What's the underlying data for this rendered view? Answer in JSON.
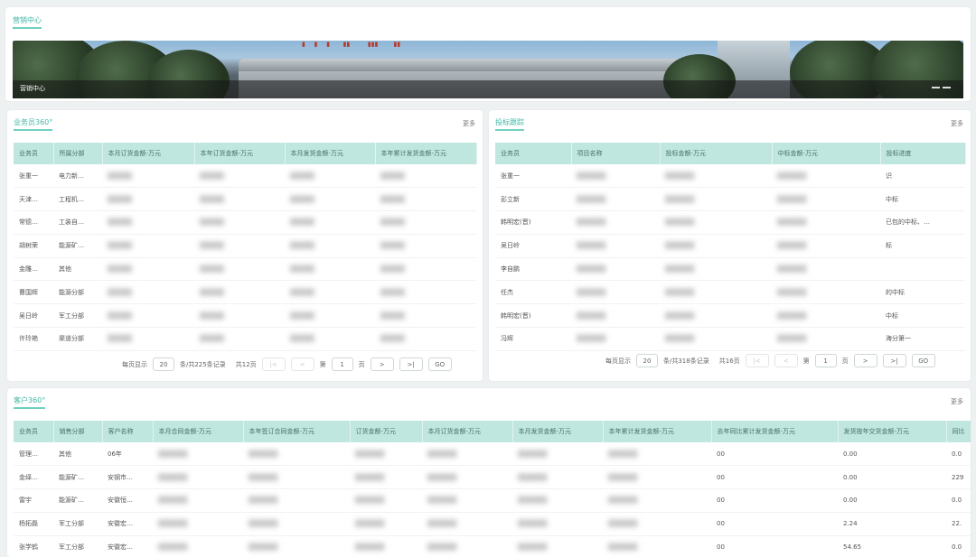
{
  "header": {
    "title": "营销中心",
    "banner_label": "营销中心"
  },
  "sales_panel": {
    "title": "业务员360°",
    "more": "更多",
    "columns": [
      "业务员",
      "所属分部",
      "本月订货金额-万元",
      "本年订货金额-万元",
      "本月发货金额-万元",
      "本年累计发货金额-万元"
    ],
    "rows": [
      [
        "张重一",
        "电力新…"
      ],
      [
        "天津…",
        "工程机…"
      ],
      [
        "常德…",
        "工装自…"
      ],
      [
        "胡树荣",
        "能源矿…"
      ],
      [
        "金雕…",
        "其他"
      ],
      [
        "曹国辉",
        "能源分部"
      ],
      [
        "吴日岭",
        "军工分部"
      ],
      [
        "许玲艳",
        "渠道分部"
      ]
    ],
    "pager": {
      "per_page_label": "每页显示",
      "per_page": "20",
      "records": "条/共225条记录",
      "total_pages": "共12页",
      "page_prefix": "第",
      "page": "1",
      "page_suffix": "页",
      "go": "GO"
    }
  },
  "bids_panel": {
    "title": "投标跟踪",
    "more": "更多",
    "columns": [
      "业务员",
      "项目名称",
      "投标金额-万元",
      "中标金额-万元",
      "投标进度"
    ],
    "rows": [
      [
        "张重一",
        "",
        "",
        "",
        "识"
      ],
      [
        "彭立新",
        "",
        "",
        "",
        "中标"
      ],
      [
        "韩明宏(晋)",
        "",
        "",
        "",
        "已包的中标、…"
      ],
      [
        "吴日岭",
        "",
        "",
        "",
        "标"
      ],
      [
        "李自鹏",
        "",
        "",
        "",
        ""
      ],
      [
        "任杰",
        "",
        "",
        "",
        "的中标"
      ],
      [
        "韩明宏(晋)",
        "",
        "",
        "",
        "中标"
      ],
      [
        "冯辉",
        "",
        "",
        "",
        "海分第一"
      ]
    ],
    "pager": {
      "per_page_label": "每页显示",
      "per_page": "20",
      "records": "条/共318条记录",
      "total_pages": "共16页",
      "page_prefix": "第",
      "page": "1",
      "page_suffix": "页",
      "go": "GO"
    }
  },
  "customer_panel": {
    "title": "客户360°",
    "more": "更多",
    "columns": [
      "业务员",
      "销售分部",
      "客户名称",
      "本月合同金额-万元",
      "本年签订合同金额-万元",
      "订货金额-万元",
      "本月订货金额-万元",
      "本月发货金额-万元",
      "本年累计发货金额-万元",
      "去年同比累计发货金额-万元",
      "发货按年交货金额-万元",
      "同比"
    ],
    "rows": [
      [
        "管理…",
        "其他",
        "06年",
        "00",
        "0.00",
        "0.0"
      ],
      [
        "金绎…",
        "能源矿…",
        "安钢市…",
        "00",
        "0.00",
        "229"
      ],
      [
        "雷宇",
        "能源矿…",
        "安徽恒…",
        "00",
        "0.00",
        "0.0"
      ],
      [
        "杨拓磊",
        "军工分部",
        "安徽宏…",
        "00",
        "2.24",
        "22."
      ],
      [
        "张学鹤",
        "军工分部",
        "安徽宏…",
        "00",
        "54.65",
        "0.0"
      ]
    ]
  },
  "colors": {
    "accent": "#41b6a5",
    "header_bg": "#bfe7df"
  }
}
